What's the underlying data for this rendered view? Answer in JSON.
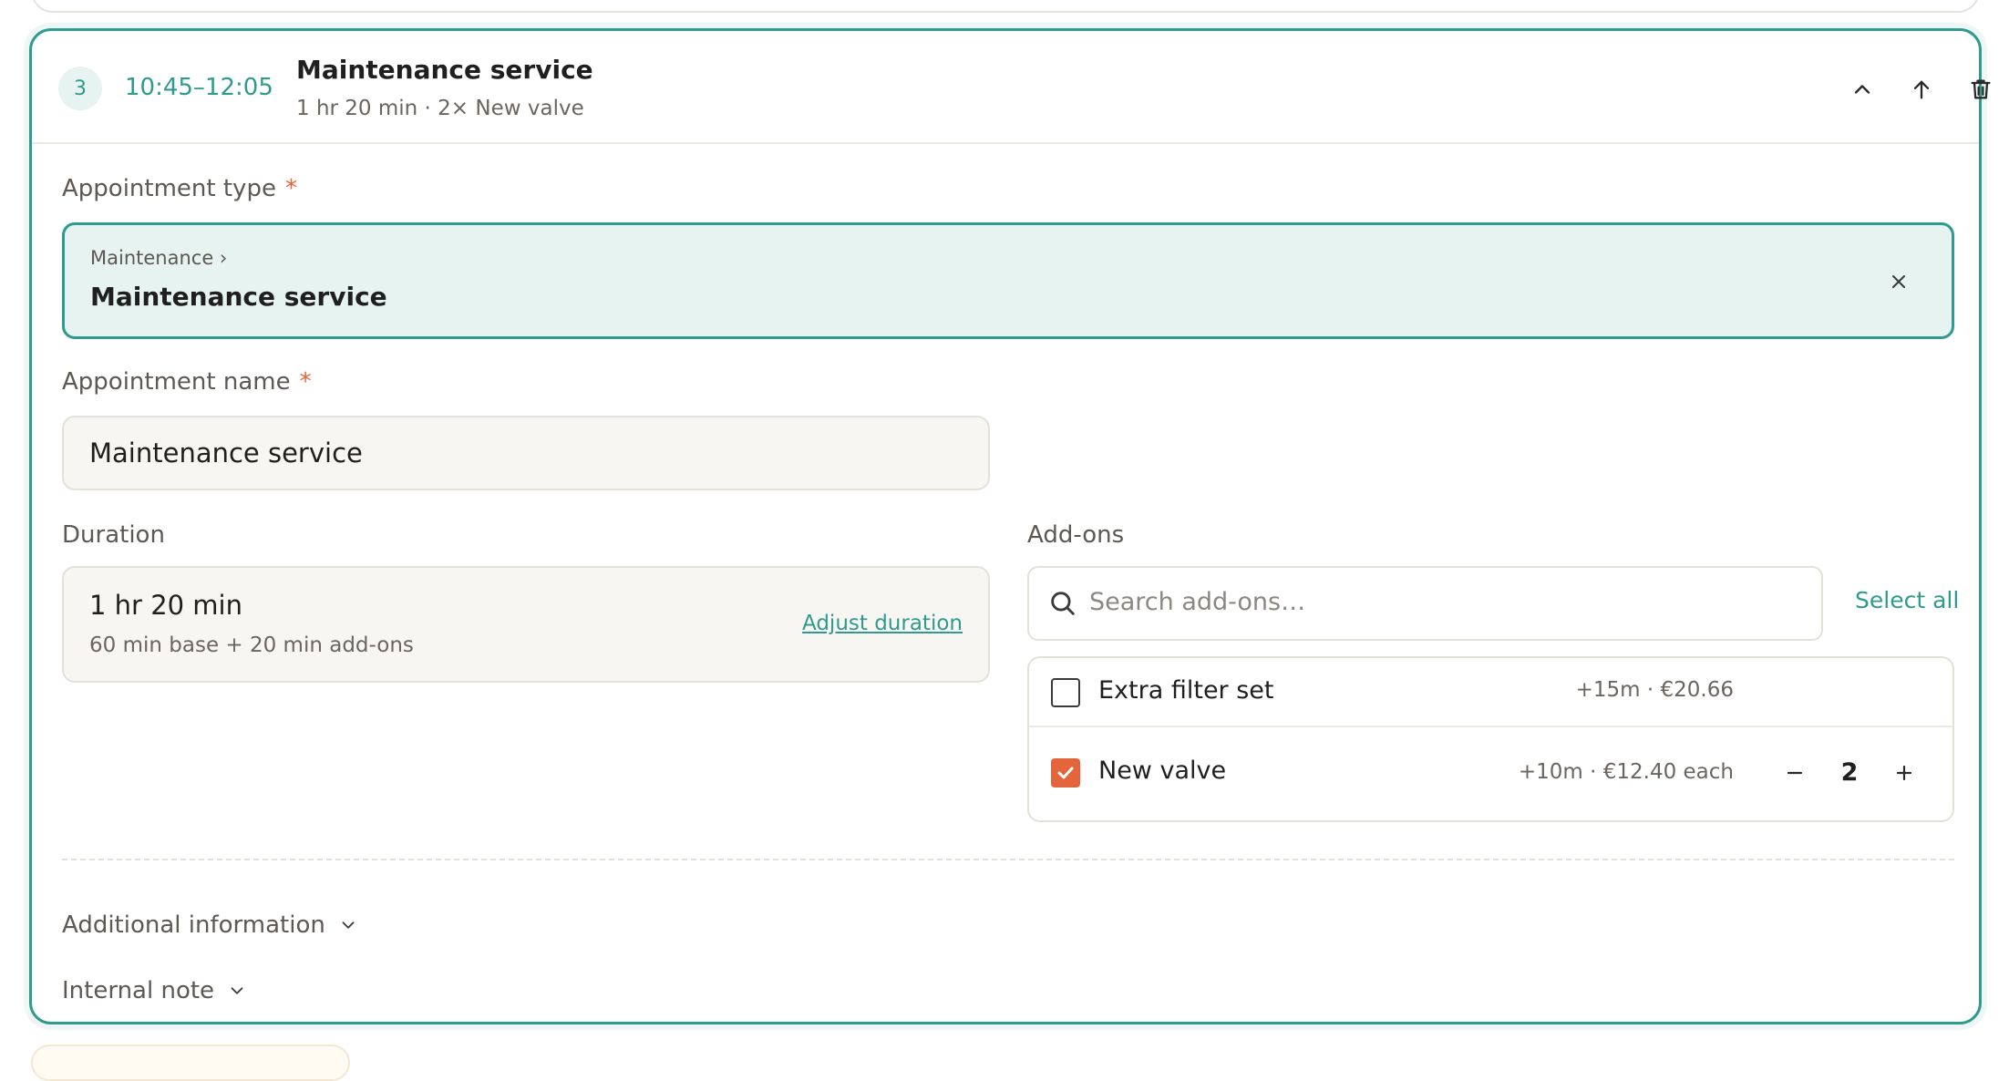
{
  "appointment": {
    "step_number": "3",
    "time_range": "10:45–12:05",
    "title": "Maintenance service",
    "summary": "1 hr 20 min · 2× New valve"
  },
  "header_actions": {
    "collapse_icon": "chevron-up-icon",
    "move_up_icon": "arrow-up-icon",
    "delete_icon": "trash-icon"
  },
  "form": {
    "type_label": "Appointment type",
    "required_marker": "*",
    "type_category": "Maintenance ›",
    "type_value": "Maintenance service",
    "name_label": "Appointment name",
    "name_value": "Maintenance service",
    "duration_label": "Duration",
    "duration_value": "1 hr 20 min",
    "duration_breakdown": "60 min base + 20 min add-ons",
    "adjust_duration_link": "Adjust duration",
    "addons_label": "Add-ons",
    "addons_search_placeholder": "Search add-ons…",
    "select_all_label": "Select all"
  },
  "addons": [
    {
      "name": "Extra filter set",
      "meta": "+15m · €20.66",
      "checked": false
    },
    {
      "name": "New valve",
      "meta": "+10m · €12.40 each",
      "checked": true,
      "quantity": "2"
    }
  ],
  "sections": {
    "additional_info": "Additional information",
    "internal_note": "Internal note"
  },
  "colors": {
    "accent": "#2e9b8e",
    "accent_bg": "#e7f3f1",
    "checkbox_checked": "#e4643b",
    "required": "#e4643b",
    "field_bg": "#f8f6f2"
  }
}
